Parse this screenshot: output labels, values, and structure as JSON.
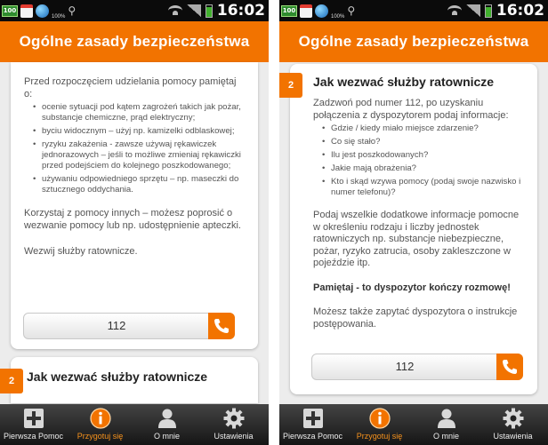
{
  "status_bar": {
    "time": "16:02",
    "battery_small_label": "100",
    "percent_label": "100%"
  },
  "app_title": "Ogólne zasady bezpieczeństwa",
  "left_screen": {
    "intro": "Przed rozpoczęciem udzielania pomocy pamiętaj o:",
    "bullets": [
      "ocenie sytuacji pod kątem zagrożeń takich jak pożar, substancje chemiczne, prąd elektryczny;",
      "byciu widocznym – użyj np. kamizelki odblaskowej;",
      "ryzyku zakażenia - zawsze używaj rękawiczek jednorazowych – jeśli to możliwe zmieniaj rękawiczki przed podejściem do kolejnego poszkodowanego;",
      "używaniu odpowiedniego sprzętu – np. maseczki do sztucznego oddychania."
    ],
    "paragraph2": "Korzystaj z pomocy innych – możesz poprosić o wezwanie pomocy lub np. udostępnienie apteczki.",
    "paragraph3": "Wezwij służby ratownicze.",
    "call_number": "112",
    "next_step_number": "2",
    "next_step_title": "Jak wezwać służby ratownicze"
  },
  "right_screen": {
    "step_number": "2",
    "step_title": "Jak wezwać służby ratownicze",
    "intro": "Zadzwoń pod numer 112, po uzyskaniu połączenia z dyspozytorem podaj informacje:",
    "bullets": [
      "Gdzie / kiedy miało miejsce zdarzenie?",
      "Co się stało?",
      "Ilu jest poszkodowanych?",
      "Jakie mają obrażenia?",
      "Kto i skąd wzywa pomocy (podaj swoje nazwisko i numer telefonu)?"
    ],
    "paragraph2": "Podaj wszelkie dodatkowe informacje pomocne w określeniu rodzaju i liczby jednostek ratowniczych np. substancje niebezpieczne, pożar, ryzyko zatrucia, osoby zakleszczone w pojeździe itp.",
    "warning": "Pamiętaj - to dyspozytor kończy rozmowę!",
    "paragraph4": "Możesz także zapytać dyspozytora o instrukcje postępowania.",
    "call_number": "112"
  },
  "bottom_nav": [
    {
      "label": "Pierwsza Pomoc",
      "icon": "plus-cross-icon",
      "active": false
    },
    {
      "label": "Przygotuj się",
      "icon": "info-icon",
      "active": true
    },
    {
      "label": "O mnie",
      "icon": "person-icon",
      "active": false
    },
    {
      "label": "Ustawienia",
      "icon": "gear-icon",
      "active": false
    }
  ],
  "colors": {
    "accent": "#f27300",
    "active_nav": "#f7931e",
    "bottom_bar": "#1a1a1a"
  }
}
